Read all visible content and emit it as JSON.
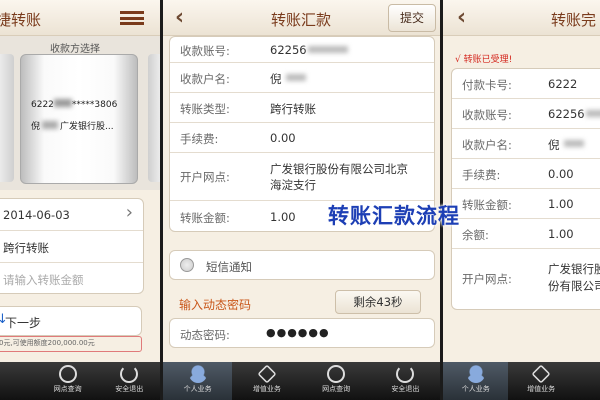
{
  "left": {
    "title": "捷转账",
    "method_title": "收款方选择",
    "card_number": "6222",
    "card_masked": "*****3806",
    "card_name": "倪",
    "card_bank": "广发银行股...",
    "date": "2014-06-03",
    "transfer_type": "跨行转账",
    "amount_placeholder": "请输入转账金额",
    "next_button": "下一步",
    "limit_note": "0元,可使用额度200,000.00元"
  },
  "middle": {
    "title": "转账汇款",
    "submit": "提交",
    "rows": [
      {
        "label": "收款账号:",
        "value": "62256"
      },
      {
        "label": "收款户名:",
        "value": "倪"
      },
      {
        "label": "转账类型:",
        "value": "跨行转账"
      },
      {
        "label": "手续费:",
        "value": "0.00"
      },
      {
        "label": "开户网点:",
        "value": "广发银行股份有限公司北京海淀支行"
      },
      {
        "label": "转账金额:",
        "value": "1.00"
      }
    ],
    "sms_label": "短信通知",
    "otp_title": "输入动态密码",
    "otp_countdown": "剩余43秒",
    "otp_label": "动态密码:",
    "otp_value": "●●●●●●"
  },
  "right": {
    "title": "转账完",
    "accepted": "√ 转账已受理!",
    "rows": [
      {
        "label": "付款卡号:",
        "value": "6222"
      },
      {
        "label": "收款账号:",
        "value": "62256"
      },
      {
        "label": "收款户名:",
        "value": "倪"
      },
      {
        "label": "手续费:",
        "value": "0.00"
      },
      {
        "label": "转账金额:",
        "value": "1.00"
      },
      {
        "label": "余额:",
        "value": "1.00"
      },
      {
        "label": "开户网点:",
        "value": "广发银行股份有限公司北京海淀支行"
      }
    ]
  },
  "overlay": "转账汇款流程",
  "tabs": {
    "t1": "网点查询",
    "t2": "安全退出",
    "t3": "个人业务",
    "t4": "增值业务",
    "t5": "网点查询",
    "t6": "安全退出",
    "t7": "个人业务",
    "t8": "增值业务"
  },
  "colors": {
    "brand": "#7a3b1c",
    "overlay": "#1d3fb5",
    "accent_red": "#d4281f",
    "otp_orange": "#c9571a"
  }
}
